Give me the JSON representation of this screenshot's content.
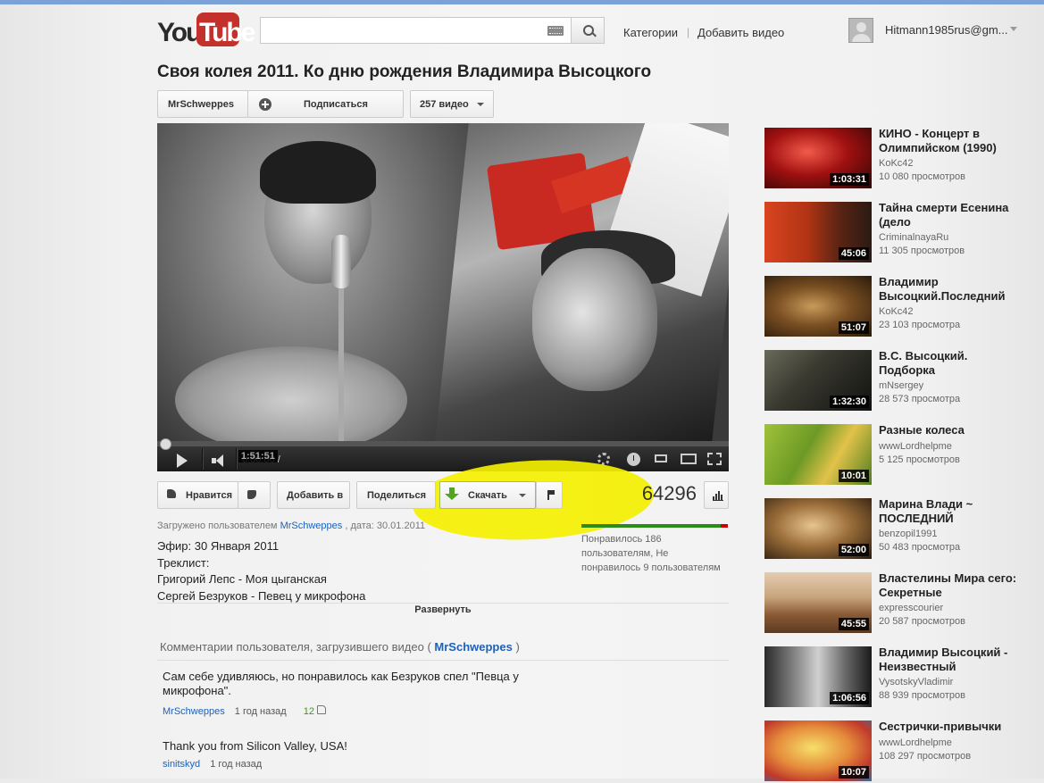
{
  "header": {
    "logo_you": "You",
    "logo_tube": "Tube",
    "search_value": "",
    "nav_categories": "Категории",
    "nav_upload": "Добавить видео",
    "username": "Hitmann1985rus@gm..."
  },
  "video": {
    "title": "Своя колея 2011. Ко дню рождения Владимира Высоцкого",
    "channel": "MrSchweppes",
    "subscribe": "Подписаться",
    "video_count": "257 видео",
    "current_time": "0:00:00",
    "duration": "1:51:51",
    "progress_fraction": 0.0
  },
  "actions": {
    "like": "Нравится",
    "add_to": "Добавить в",
    "share": "Поделиться",
    "download": "Скачать",
    "views": "64296",
    "likes_fraction": 0.954,
    "likes_text_1": "Понравилось 186",
    "likes_text_2": "пользователям, Не",
    "likes_text_3": "понравилось 9 пользователям"
  },
  "description": {
    "uploaded_prefix": "Загружено пользователем",
    "uploader": "MrSchweppes",
    "uploaded_date": ", дата: 30.01.2011",
    "line1": "Эфир: 30 Января 2011",
    "line2": "Треклист:",
    "line3": "Григорий Лепс - Моя цыганская",
    "line4": "Сергей Безруков - Певец у микрофона",
    "expand": "Развернуть"
  },
  "comments": {
    "header_prefix": "Комментарии пользователя, загрузившего видео (",
    "header_channel": "MrSchweppes",
    "header_suffix": ")",
    "items": [
      {
        "text": "Сам себе удивляюсь, но понравилось как Безруков спел \"Певца у микрофона\".",
        "author": "MrSchweppes",
        "time": "1 год назад",
        "likes": "12"
      },
      {
        "text": "Thank you from Silicon Valley, USA!",
        "author": "sinitskyd",
        "time": "1 год назад"
      }
    ]
  },
  "sidebar": {
    "items": [
      {
        "title": "КИНО - Концерт в Олимпийском (1990)",
        "channel": "KoKc42",
        "views": "10 080 просмотров",
        "duration": "1:03:31"
      },
      {
        "title": "Тайна смерти Есенина (дело",
        "channel": "CriminalnayaRu",
        "views": "11 305 просмотров",
        "duration": "45:06"
      },
      {
        "title": "Владимир Высоцкий.Последний",
        "channel": "KoKc42",
        "views": "23 103 просмотра",
        "duration": "51:07"
      },
      {
        "title": "В.С. Высоцкий. Подборка",
        "channel": "mNsergey",
        "views": "28 573 просмотра",
        "duration": "1:32:30"
      },
      {
        "title": "Разные колеса",
        "channel": "wwwLordhelpme",
        "views": "5 125 просмотров",
        "duration": "10:01"
      },
      {
        "title": "Марина Влади ~ ПОСЛЕДНИЙ",
        "channel": "benzopil1991",
        "views": "50 483 просмотра",
        "duration": "52:00"
      },
      {
        "title": "Властелины Мира сего: Секретные",
        "channel": "expresscourier",
        "views": "20 587 просмотров",
        "duration": "45:55"
      },
      {
        "title": "Владимир Высоцкий - Неизвестный",
        "channel": "VysotskyVladimir",
        "views": "88 939 просмотров",
        "duration": "1:06:56"
      },
      {
        "title": "Сестрички-привычки",
        "channel": "wwwLordhelpme",
        "views": "108 297 просмотров",
        "duration": "10:07"
      }
    ]
  },
  "colors": {
    "brand_red": "#c4302b",
    "link_blue": "#1c62b9",
    "download_highlight": "#f5f000",
    "like_green": "#2c8c19",
    "dislike_red": "#cc0000"
  },
  "icons": [
    "search-icon",
    "keyboard-icon",
    "plus-icon",
    "play-icon",
    "volume-icon",
    "gear-icon",
    "clock-icon",
    "fullscreen-icon",
    "thumbs-up-icon",
    "thumbs-down-icon",
    "download-arrow-icon",
    "flag-icon",
    "stats-icon"
  ]
}
